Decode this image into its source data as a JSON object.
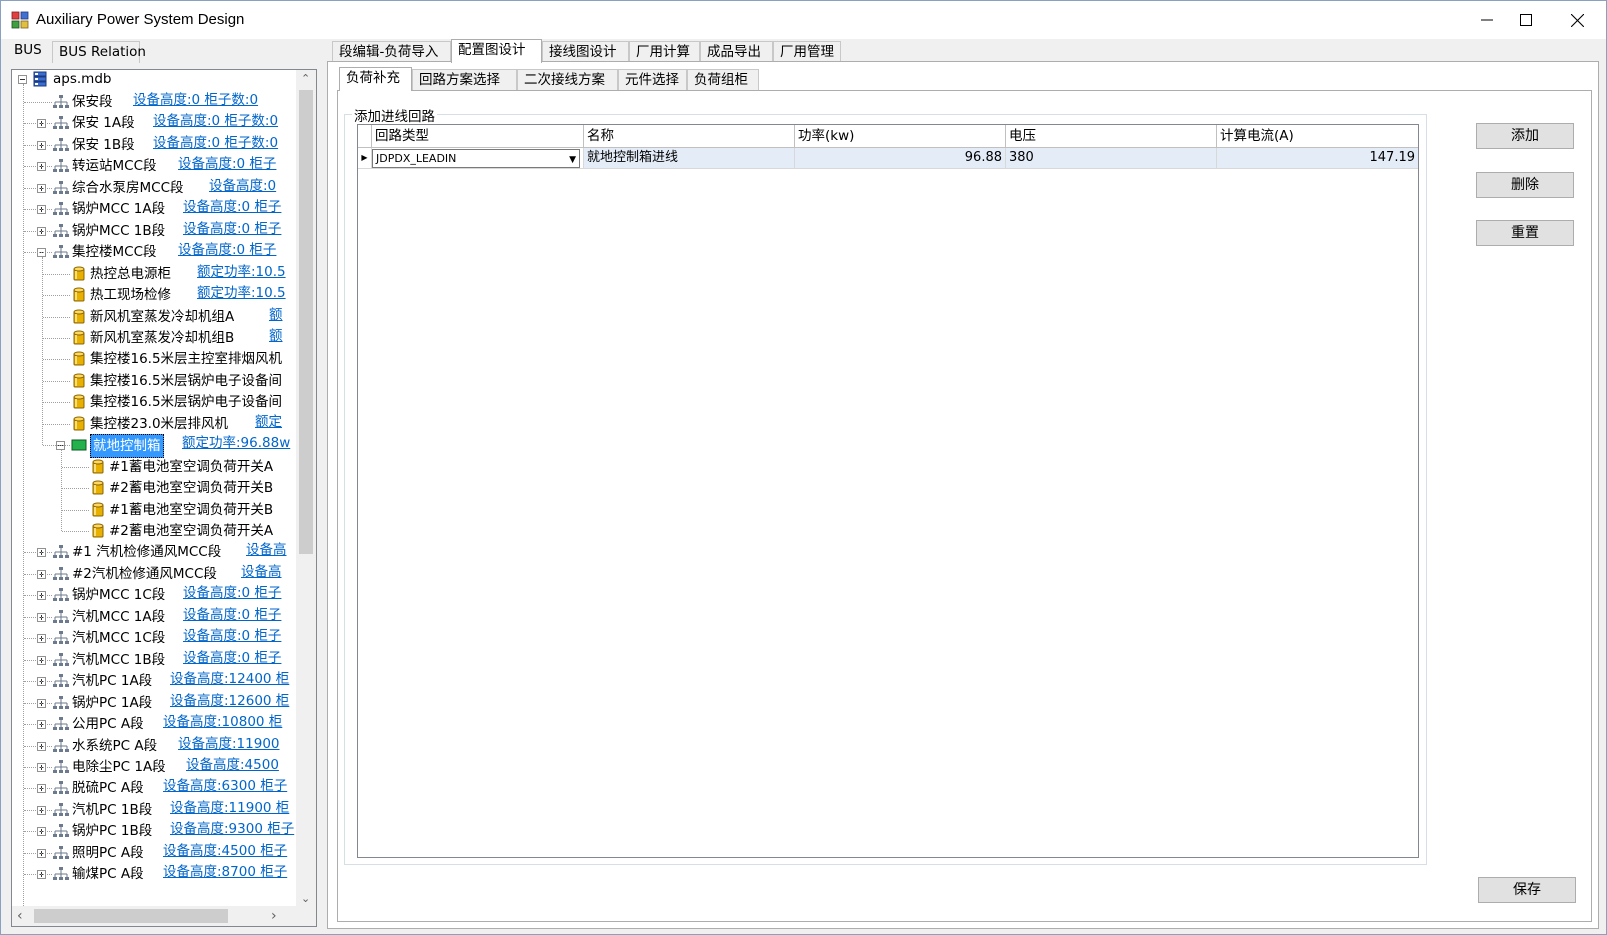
{
  "window": {
    "title": "Auxiliary Power System Design"
  },
  "left_tabs": [
    "BUS",
    "BUS Relation"
  ],
  "main_tabs": [
    "段编辑-负荷导入",
    "配置图设计",
    "接线图设计",
    "厂用计算",
    "成品导出",
    "厂用管理"
  ],
  "sub_tabs": [
    "负荷补充",
    "回路方案选择",
    "二次接线方案",
    "元件选择",
    "负荷组柜"
  ],
  "tree": {
    "root": "aps.mdb",
    "nodes": [
      {
        "label": "保安段",
        "link": "设备高度:0   柜子数:0",
        "icon": "network-icon"
      },
      {
        "label": "保安 1A段",
        "link": "设备高度:0   柜子数:0",
        "icon": "network-icon"
      },
      {
        "label": "保安 1B段",
        "link": "设备高度:0   柜子数:0",
        "icon": "network-icon"
      },
      {
        "label": "转运站MCC段",
        "link": "设备高度:0   柜子",
        "icon": "network-icon"
      },
      {
        "label": "综合水泵房MCC段",
        "link": "设备高度:0",
        "icon": "network-icon"
      },
      {
        "label": "锅炉MCC 1A段",
        "link": "设备高度:0   柜子",
        "icon": "network-icon"
      },
      {
        "label": "锅炉MCC 1B段",
        "link": "设备高度:0   柜子",
        "icon": "network-icon"
      },
      {
        "label": "集控楼MCC段",
        "link": "设备高度:0   柜子",
        "icon": "network-icon"
      },
      {
        "label": "热控总电源柜",
        "link": "额定功率:10.5",
        "icon": "cylinder-icon"
      },
      {
        "label": "热工现场检修",
        "link": "额定功率:10.5",
        "icon": "cylinder-icon"
      },
      {
        "label": "新风机室蒸发冷却机组A",
        "link": "额",
        "icon": "cylinder-icon"
      },
      {
        "label": "新风机室蒸发冷却机组B",
        "link": "额",
        "icon": "cylinder-icon"
      },
      {
        "label": "集控楼16.5米层主控室排烟风机",
        "link": "",
        "icon": "cylinder-icon"
      },
      {
        "label": "集控楼16.5米层锅炉电子设备间",
        "link": "",
        "icon": "cylinder-icon"
      },
      {
        "label": "集控楼16.5米层锅炉电子设备间",
        "link": "",
        "icon": "cylinder-icon"
      },
      {
        "label": "集控楼23.0米层排风机",
        "link": "额定",
        "icon": "cylinder-icon"
      },
      {
        "label": "就地控制箱",
        "link": "额定功率:96.88w",
        "icon": "green-box-icon"
      },
      {
        "label": "#1蓄电池室空调负荷开关A",
        "link": "",
        "icon": "cylinder-icon"
      },
      {
        "label": "#2蓄电池室空调负荷开关B",
        "link": "",
        "icon": "cylinder-icon"
      },
      {
        "label": "#1蓄电池室空调负荷开关B",
        "link": "",
        "icon": "cylinder-icon"
      },
      {
        "label": "#2蓄电池室空调负荷开关A",
        "link": "",
        "icon": "cylinder-icon"
      },
      {
        "label": "#1 汽机检修通风MCC段",
        "link": "设备高",
        "icon": "network-icon"
      },
      {
        "label": "#2汽机检修通风MCC段",
        "link": "设备高",
        "icon": "network-icon"
      },
      {
        "label": "锅炉MCC 1C段",
        "link": "设备高度:0   柜子",
        "icon": "network-icon"
      },
      {
        "label": "汽机MCC 1A段",
        "link": "设备高度:0   柜子",
        "icon": "network-icon"
      },
      {
        "label": "汽机MCC 1C段",
        "link": "设备高度:0   柜子",
        "icon": "network-icon"
      },
      {
        "label": "汽机MCC 1B段",
        "link": "设备高度:0   柜子",
        "icon": "network-icon"
      },
      {
        "label": "汽机PC 1A段",
        "link": "设备高度:12400   柜",
        "icon": "network-icon"
      },
      {
        "label": "锅炉PC 1A段",
        "link": "设备高度:12600   柜",
        "icon": "network-icon"
      },
      {
        "label": "公用PC A段",
        "link": "设备高度:10800   柜",
        "icon": "network-icon"
      },
      {
        "label": "水系统PC A段",
        "link": "设备高度:11900",
        "icon": "network-icon"
      },
      {
        "label": "电除尘PC 1A段",
        "link": "设备高度:4500",
        "icon": "network-icon"
      },
      {
        "label": "脱硫PC A段",
        "link": "设备高度:6300   柜子",
        "icon": "network-icon"
      },
      {
        "label": "汽机PC 1B段",
        "link": "设备高度:11900   柜",
        "icon": "network-icon"
      },
      {
        "label": "锅炉PC 1B段",
        "link": "设备高度:9300   柜子",
        "icon": "network-icon"
      },
      {
        "label": "照明PC A段",
        "link": "设备高度:4500   柜子",
        "icon": "network-icon"
      },
      {
        "label": "输煤PC A段",
        "link": "设备高度:8700   柜子",
        "icon": "network-icon"
      }
    ]
  },
  "groupbox": {
    "title": "添加进线回路"
  },
  "grid": {
    "columns": [
      "回路类型",
      "名称",
      "功率(kw)",
      "电压",
      "计算电流(A)"
    ],
    "rows": [
      {
        "type": "JDPDX_LEADIN",
        "name": "就地控制箱进线",
        "power": "96.88",
        "voltage": "380",
        "current": "147.19"
      }
    ]
  },
  "buttons": {
    "add": "添加",
    "delete": "删除",
    "reset": "重置",
    "save": "保存"
  }
}
